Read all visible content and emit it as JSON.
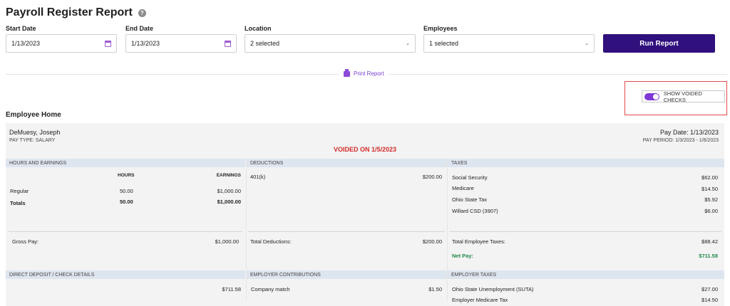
{
  "header": {
    "title": "Payroll Register Report",
    "help_icon": "question-circle-icon",
    "help_glyph": "?"
  },
  "filters": {
    "start_date": {
      "label": "Start Date",
      "value": "1/13/2023",
      "icon": "calendar-icon"
    },
    "end_date": {
      "label": "End Date",
      "value": "1/13/2023",
      "icon": "calendar-icon"
    },
    "location": {
      "label": "Location",
      "value": "2 selected",
      "icon": "chevron-down-icon",
      "glyph": "⌄"
    },
    "employees": {
      "label": "Employees",
      "value": "1 selected",
      "icon": "chevron-down-icon",
      "glyph": "⌄"
    },
    "run_button": "Run Report"
  },
  "print_report": {
    "label": "Print Report",
    "icon": "printer-icon"
  },
  "voided_toggle": {
    "label": "SHOW VOIDED CHECKS",
    "on": true,
    "accent": "#7f38d6",
    "highlight": "#e14a4a"
  },
  "section": {
    "title": "Employee Home"
  },
  "employee": {
    "name": "DeMuesy, Joseph",
    "pay_type": "PAY TYPE: SALARY",
    "voided": "VOIDED ON 1/5/2023",
    "pay_date": "Pay Date: 1/13/2023",
    "pay_period": "PAY PERIOD: 1/3/2023 - 1/6/2023"
  },
  "hours_earnings": {
    "header": "HOURS AND EARNINGS",
    "col_hours": "HOURS",
    "col_earnings": "EARNINGS",
    "rows": [
      {
        "label": "Regular",
        "hours": "50.00",
        "earnings": "$1,000.00"
      },
      {
        "label": "Totals",
        "hours": "50.00",
        "earnings": "$1,000.00"
      }
    ],
    "gross_label": "Gross Pay:",
    "gross_value": "$1,000.00"
  },
  "deductions": {
    "header": "DEDUCTIONS",
    "rows": [
      {
        "label": "401(k)",
        "value": "$200.00"
      }
    ],
    "total_label": "Total Deductions:",
    "total_value": "$200.00"
  },
  "taxes": {
    "header": "TAXES",
    "rows": [
      {
        "label": "Social Security",
        "value": "$62.00"
      },
      {
        "label": "Medicare",
        "value": "$14.50"
      },
      {
        "label": "Ohio State Tax",
        "value": "$5.92"
      },
      {
        "label": "Willard CSD (3907)",
        "value": "$6.00"
      }
    ],
    "total_label": "Total Employee Taxes:",
    "total_value": "$88.42",
    "net_label": "Net Pay:",
    "net_value": "$711.58"
  },
  "direct_deposit": {
    "header": "DIRECT DEPOSIT / CHECK DETAILS",
    "value": "$711.58"
  },
  "employer_contributions": {
    "header": "EMPLOYER CONTRIBUTIONS",
    "rows": [
      {
        "label": "Company match",
        "value": "$1.50"
      }
    ]
  },
  "employer_taxes": {
    "header": "EMPLOYER TAXES",
    "rows": [
      {
        "label": "Ohio State Unemployment (SUTA)",
        "value": "$27.00"
      },
      {
        "label": "Employer Medicare Tax",
        "value": "$14.50"
      }
    ]
  }
}
